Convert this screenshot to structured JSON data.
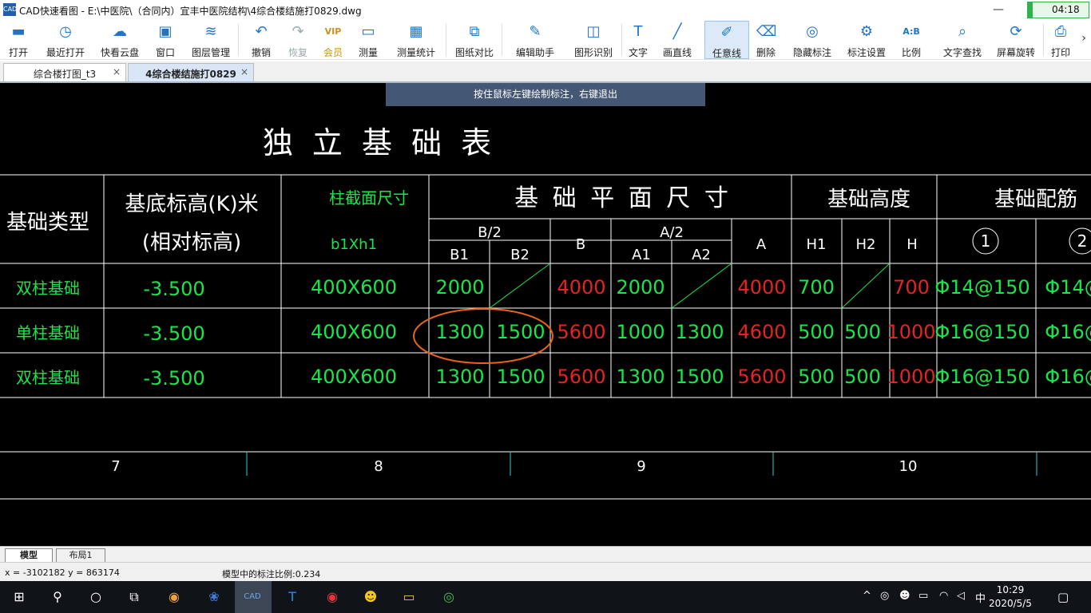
{
  "window": {
    "app_icon": "CAD",
    "title": "CAD快速看图 - E:\\中医院\\（合同内）宜丰中医院结构\\4综合楼结施打0829.dwg",
    "minimize_icon": "minimize-icon",
    "timer": "04:18"
  },
  "toolbar": [
    {
      "label": "打开",
      "icon": "folder-icon",
      "glyph": "▬"
    },
    {
      "label": "最近打开",
      "icon": "clock-icon",
      "glyph": "◷"
    },
    {
      "label": "快看云盘",
      "icon": "cloud-icon",
      "glyph": "☁"
    },
    {
      "label": "窗口",
      "icon": "window-icon",
      "glyph": "▣"
    },
    {
      "label": "图层管理",
      "icon": "layers-icon",
      "glyph": "≋"
    },
    {
      "label": "撤销",
      "icon": "undo-icon",
      "glyph": "↶"
    },
    {
      "label": "恢复",
      "icon": "redo-icon",
      "glyph": "↷"
    },
    {
      "label": "会员",
      "icon": "vip-icon",
      "glyph": "VIP"
    },
    {
      "label": "测量",
      "icon": "ruler-icon",
      "glyph": "▭"
    },
    {
      "label": "测量统计",
      "icon": "measure-stats-icon",
      "glyph": "▦"
    },
    {
      "label": "图纸对比",
      "icon": "compare-icon",
      "glyph": "⧉"
    },
    {
      "label": "编辑助手",
      "icon": "edit-assistant-icon",
      "glyph": "✎"
    },
    {
      "label": "图形识别",
      "icon": "shape-recognize-icon",
      "glyph": "◫"
    },
    {
      "label": "文字",
      "icon": "text-icon",
      "glyph": "T"
    },
    {
      "label": "画直线",
      "icon": "line-icon",
      "glyph": "╱"
    },
    {
      "label": "任意线",
      "icon": "freehand-icon",
      "glyph": "✐"
    },
    {
      "label": "删除",
      "icon": "eraser-icon",
      "glyph": "⌫"
    },
    {
      "label": "隐藏标注",
      "icon": "hide-annotation-icon",
      "glyph": "◎"
    },
    {
      "label": "标注设置",
      "icon": "annotation-settings-icon",
      "glyph": "⚙"
    },
    {
      "label": "比例",
      "icon": "scale-icon",
      "glyph": "A:B"
    },
    {
      "label": "文字查找",
      "icon": "text-search-icon",
      "glyph": "⌕"
    },
    {
      "label": "屏幕旋转",
      "icon": "rotate-screen-icon",
      "glyph": "⟳"
    },
    {
      "label": "打印",
      "icon": "print-icon",
      "glyph": "⎙"
    }
  ],
  "toolbar_more_icon": "chevron-right-icon",
  "tabs": [
    {
      "label": "综合楼打图_t3",
      "close": "×"
    },
    {
      "label": "4综合楼结施打0829",
      "close": "×"
    }
  ],
  "canvas": {
    "hint": "按住鼠标左键绘制标注，右键退出",
    "title": "独 立 基 础 表",
    "headers": {
      "type": "基础类型",
      "elev_line1": "基底标高(K)米",
      "elev_line2": "(相对标高)",
      "col_section": "柱截面尺寸",
      "col_section_sub": "b1Xh1",
      "plan_size": "基 础 平 面 尺 寸",
      "height": "基础高度",
      "rebar": "基础配筋",
      "b_half": "B/2",
      "b1": "B1",
      "b2": "B2",
      "b": "B",
      "a_half": "A/2",
      "a1": "A1",
      "a2": "A2",
      "a": "A",
      "h1": "H1",
      "h2": "H2",
      "h": "H",
      "rebar1": "1",
      "rebar2": "2"
    },
    "rows": [
      {
        "type": "双柱基础",
        "elev": "-3.500",
        "section": "400X600",
        "b1": "2000",
        "b2": "",
        "b": "4000",
        "a1": "2000",
        "a2": "",
        "a": "4000",
        "h1": "700",
        "h2": "",
        "h": "700",
        "r1": "Φ14@150",
        "r2": "Φ14@"
      },
      {
        "type": "单柱基础",
        "elev": "-3.500",
        "section": "400X600",
        "b1": "1300",
        "b2": "1500",
        "b": "5600",
        "a1": "1000",
        "a2": "1300",
        "a": "4600",
        "h1": "500",
        "h2": "500",
        "h": "1000",
        "r1": "Φ16@150",
        "r2": "Φ16@"
      },
      {
        "type": "双柱基础",
        "elev": "-3.500",
        "section": "400X600",
        "b1": "1300",
        "b2": "1500",
        "b": "5600",
        "a1": "1300",
        "a2": "1500",
        "a": "5600",
        "h1": "500",
        "h2": "500",
        "h": "1000",
        "r1": "Φ16@150",
        "r2": "Φ16@"
      }
    ],
    "axis_labels": [
      "7",
      "8",
      "9",
      "10"
    ],
    "colors": {
      "green": "#19e64b",
      "red": "#e62323",
      "white": "#ffffff",
      "annotation": "#e8641e"
    }
  },
  "layout_tabs": [
    "模型",
    "布局1"
  ],
  "status": {
    "coords": "x = -3102182  y = 863174",
    "scale": "模型中的标注比例:0.234"
  },
  "taskbar": {
    "apps": [
      {
        "icon": "windows-start-icon",
        "glyph": "⊞"
      },
      {
        "icon": "search-icon",
        "glyph": "⚲"
      },
      {
        "icon": "cortana-icon",
        "glyph": "○"
      },
      {
        "icon": "task-view-icon",
        "glyph": "⧉"
      },
      {
        "icon": "browser-icon",
        "glyph": "◉"
      },
      {
        "icon": "cloud-app-icon",
        "glyph": "❀"
      },
      {
        "icon": "cad-app-icon",
        "glyph": "CAD"
      },
      {
        "icon": "text-app-icon",
        "glyph": "T"
      },
      {
        "icon": "music-app-icon",
        "glyph": "◉"
      },
      {
        "icon": "qq-icon",
        "glyph": "☻"
      },
      {
        "icon": "file-explorer-icon",
        "glyph": "▭"
      },
      {
        "icon": "wechat-icon",
        "glyph": "◎"
      }
    ],
    "tray": [
      {
        "icon": "tray-up-icon",
        "glyph": "^"
      },
      {
        "icon": "tray-wechat-icon",
        "glyph": "◎"
      },
      {
        "icon": "tray-qq-icon",
        "glyph": "☻"
      },
      {
        "icon": "battery-icon",
        "glyph": "▭"
      },
      {
        "icon": "wifi-icon",
        "glyph": "◠"
      },
      {
        "icon": "volume-icon",
        "glyph": "◁"
      }
    ],
    "ime": "中",
    "time": "10:29",
    "date": "2020/5/5",
    "notification_icon": "notification-icon"
  }
}
